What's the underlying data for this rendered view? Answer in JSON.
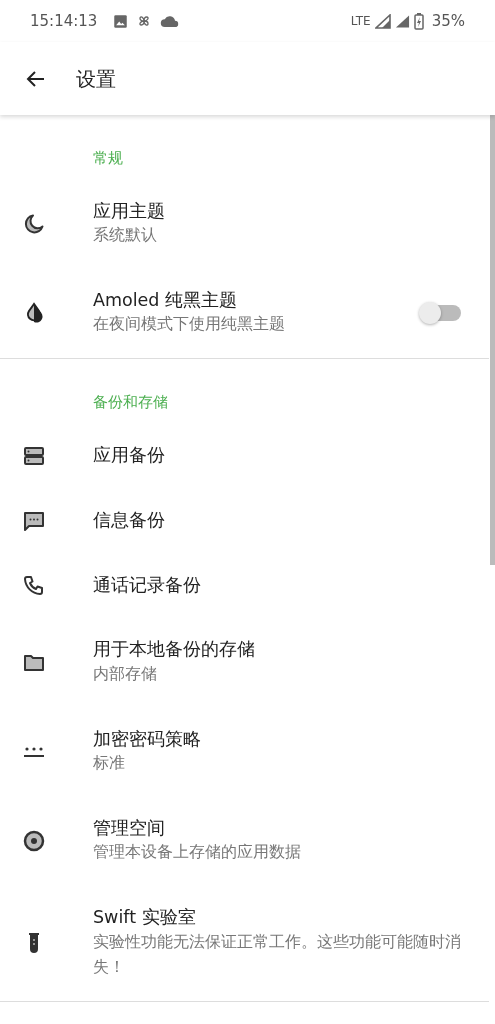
{
  "status_bar": {
    "time": "15:14:13",
    "network": "LTE",
    "battery": "35%"
  },
  "app_bar": {
    "title": "设置"
  },
  "sections": [
    {
      "header": "常规",
      "items": [
        {
          "kind": "plain",
          "title": "应用主题",
          "subtitle": "系统默认"
        },
        {
          "kind": "switch",
          "title": "Amoled 纯黑主题",
          "subtitle": "在夜间模式下使用纯黑主题",
          "on": false
        }
      ]
    },
    {
      "header": "备份和存储",
      "items": [
        {
          "kind": "plain",
          "title": "应用备份"
        },
        {
          "kind": "plain",
          "title": "信息备份"
        },
        {
          "kind": "plain",
          "title": "通话记录备份"
        },
        {
          "kind": "plain",
          "title": "用于本地备份的存储",
          "subtitle": "内部存储"
        },
        {
          "kind": "plain",
          "title": "加密密码策略",
          "subtitle": "标准"
        },
        {
          "kind": "plain",
          "title": "管理空间",
          "subtitle": "管理本设备上存储的应用数据"
        },
        {
          "kind": "plain",
          "title": "Swift 实验室",
          "subtitle": "实验性功能无法保证正常工作。这些功能可能随时消失！"
        }
      ]
    }
  ]
}
